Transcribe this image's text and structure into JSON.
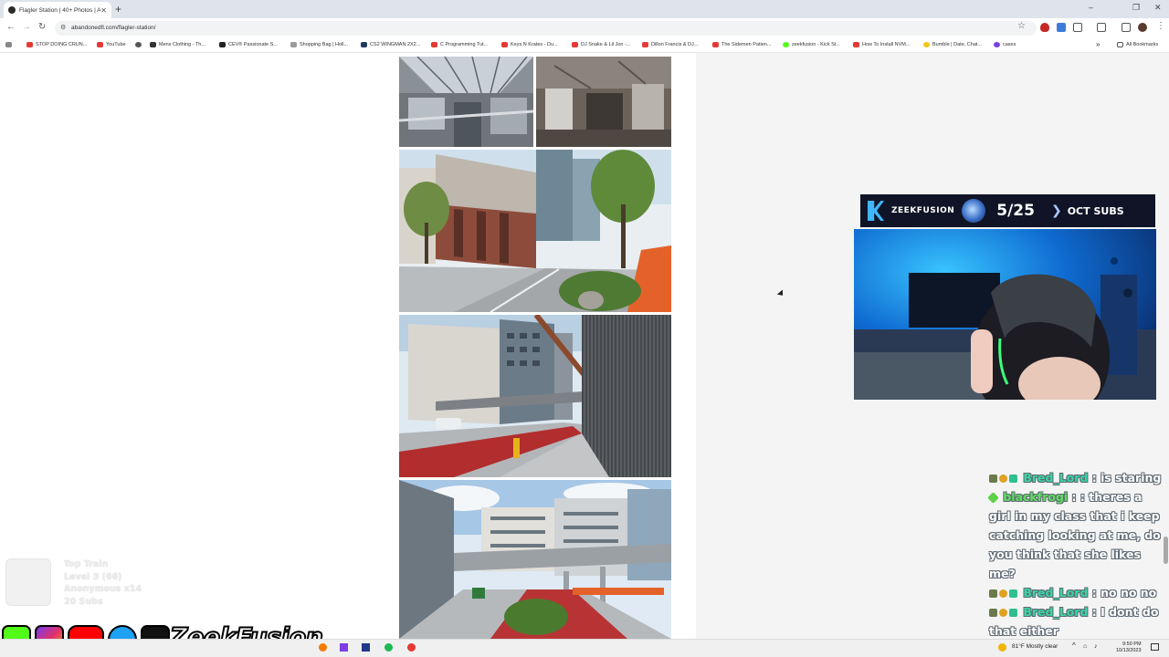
{
  "browser": {
    "tab_title": "Flagler Station | 40+ Photos | A",
    "new_tab_label": "+",
    "url": "abandonedfl.com/flagler-station/",
    "window_controls": [
      "–",
      "❐",
      "✕"
    ]
  },
  "bookmarks": [
    {
      "label": "STOP DOING CRUN...",
      "color": "#e53935"
    },
    {
      "label": "YouTube",
      "color": "#e53935"
    },
    {
      "label": "",
      "color": "#555555"
    },
    {
      "label": "Mens Clothing - Th...",
      "color": "#333333"
    },
    {
      "label": "CEV® Passionate S...",
      "color": "#222222"
    },
    {
      "label": "Shopping Bag | Holl...",
      "color": "#9a9a9a"
    },
    {
      "label": "CS2 WINGMAN 2X2...",
      "color": "#1f3a5f"
    },
    {
      "label": "C Programming Tut...",
      "color": "#e53935"
    },
    {
      "label": "Keys N Krates - Du...",
      "color": "#e53935"
    },
    {
      "label": "DJ Snake & Lil Jon -...",
      "color": "#e53935"
    },
    {
      "label": "Dillon Francis & DJ...",
      "color": "#e53935"
    },
    {
      "label": "The Sidemen Patien...",
      "color": "#e53935"
    },
    {
      "label": "zeekfusion - Kick St...",
      "color": "#53fc18"
    },
    {
      "label": "How To Install NVM...",
      "color": "#e53935"
    },
    {
      "label": "Bumble | Date, Chat...",
      "color": "#f5c518"
    },
    {
      "label": "cases",
      "color": "#7b3fe4"
    }
  ],
  "all_bookmarks_label": "All Bookmarks",
  "overlay": {
    "subs_brand": "ZEEKFUSION",
    "subs_count": "5/25",
    "subs_label": "OCT SUBS",
    "train": {
      "title": "Top Train",
      "level": "Level 3 (66)",
      "anon": "Anonymous x14",
      "subs": "20 Subs"
    },
    "social_name": "ZeekFusion"
  },
  "chat": [
    {
      "user": "Bred_Lord",
      "sep": " : ",
      "text": "is staring",
      "style": "mod"
    },
    {
      "user": "blackfrogi",
      "sep": " : ",
      "text": ": theres a girl in my class that i keep catching looking at me, do you think that she likes me?",
      "style": "plain"
    },
    {
      "user": "Bred_Lord",
      "sep": " : ",
      "text": "no no no",
      "style": "mod"
    },
    {
      "user": "Bred_Lord",
      "sep": " : ",
      "text": "I dont do that either",
      "style": "mod"
    }
  ],
  "taskbar": {
    "weather": "81°F  Mostly clear",
    "time": "9:50 PM",
    "date": "10/13/2023"
  }
}
